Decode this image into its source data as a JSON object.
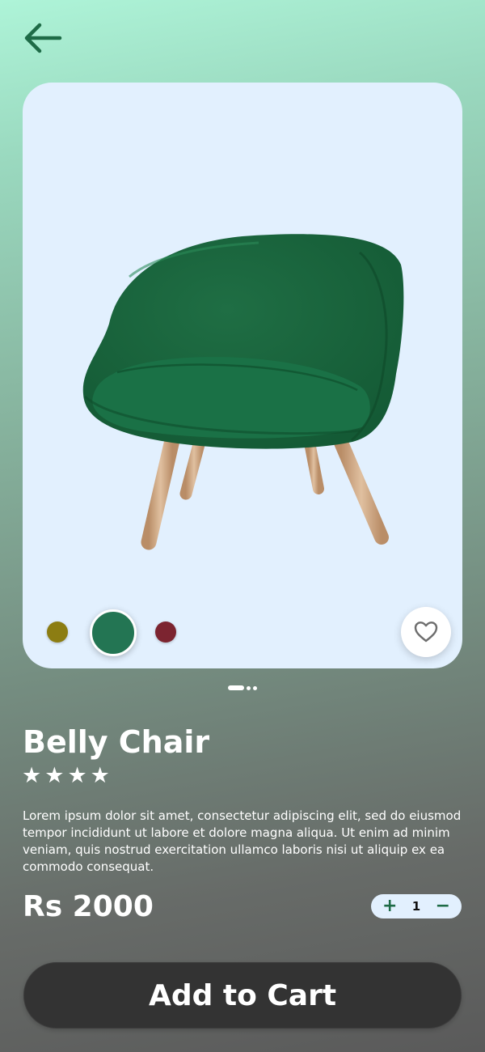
{
  "header": {
    "back_icon": "arrow-left-icon"
  },
  "product": {
    "image_icon": "green-armchair-image",
    "name": "Belly Chair",
    "rating_stars": 4,
    "star_glyph": "★",
    "description": "Lorem ipsum dolor sit amet, consectetur adipiscing elit, sed do eiusmod tempor incididunt ut labore et dolore magna aliqua. Ut enim ad minim veniam, quis nostrud exercitation ullamco laboris nisi ut aliquip ex ea commodo consequat.",
    "price": "Rs 2000"
  },
  "colors": {
    "options": [
      "#8c7d12",
      "#237553",
      "#7c2430"
    ],
    "selected": "#237553"
  },
  "favorite": {
    "icon": "heart-outline-icon"
  },
  "pager": {
    "count": 3,
    "active": 0
  },
  "quantity": {
    "plus": "+",
    "value": "1",
    "minus": "−"
  },
  "cart": {
    "label": "Add to Cart"
  },
  "theme": {
    "accent_green": "#1e6b47",
    "card_background": "#e2f0fe",
    "button_dark": "#333333"
  }
}
